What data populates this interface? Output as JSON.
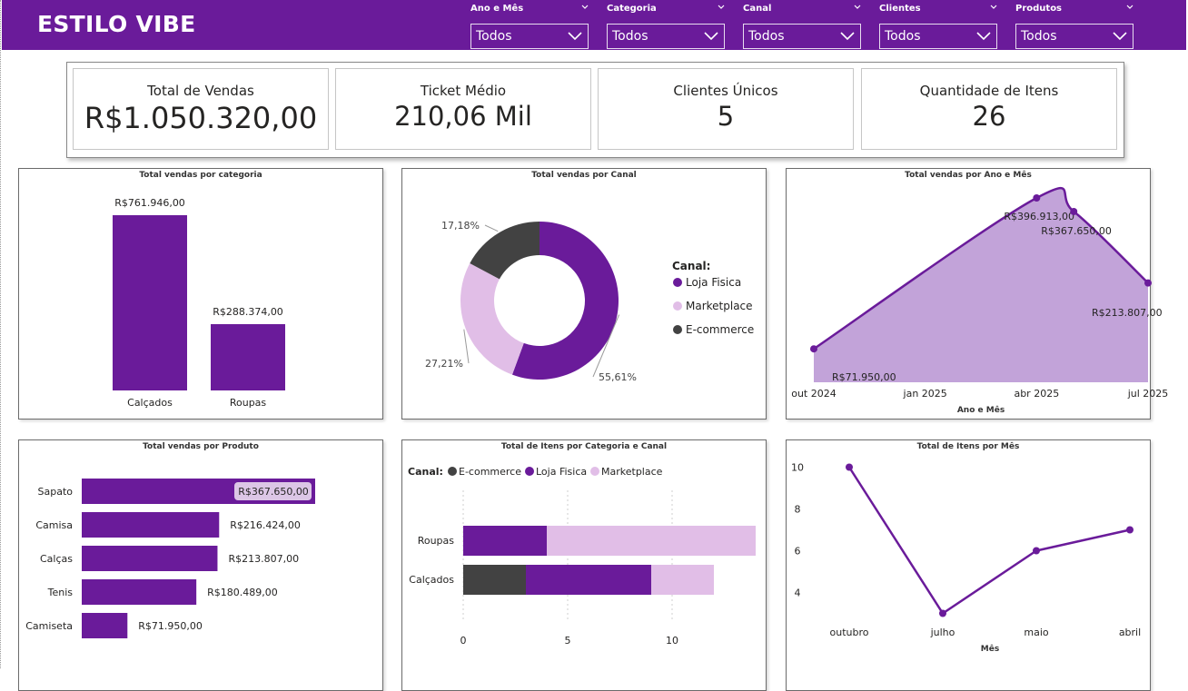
{
  "header": {
    "title": "ESTILO VIBE",
    "background_color": "#6a1b9a",
    "filters": [
      {
        "label": "Ano e Mês",
        "value": "Todos"
      },
      {
        "label": "Categoria",
        "value": "Todos"
      },
      {
        "label": "Canal",
        "value": "Todos"
      },
      {
        "label": "Clientes",
        "value": "Todos"
      },
      {
        "label": "Produtos",
        "value": "Todos"
      }
    ]
  },
  "kpis": [
    {
      "label": "Total de Vendas",
      "value": "R$1.050.320,00"
    },
    {
      "label": "Ticket Médio",
      "value": "210,06 Mil"
    },
    {
      "label": "Clientes Únicos",
      "value": "5"
    },
    {
      "label": "Quantidade de Itens",
      "value": "26"
    }
  ],
  "colors": {
    "loja_fisica": "#6a1b9a",
    "marketplace": "#e1bee7",
    "ecommerce": "#424242",
    "area_fill": "#c2a3d9"
  },
  "chart_data": [
    {
      "type": "bar",
      "title": "Total vendas por categoria",
      "categories": [
        "Calçados",
        "Roupas"
      ],
      "values": [
        761946,
        288374
      ],
      "labels": [
        "R$761.946,00",
        "R$288.374,00"
      ]
    },
    {
      "type": "pie",
      "title": "Total vendas por Canal",
      "legend_title": "Canal:",
      "legend_position": "right",
      "categories": [
        "Loja Fisica",
        "Marketplace",
        "E-commerce"
      ],
      "values": [
        55.61,
        27.21,
        17.18
      ],
      "labels": [
        "55,61%",
        "27,21%",
        "17,18%"
      ]
    },
    {
      "type": "area",
      "title": "Total vendas por Ano e Mês",
      "xlabel": "Ano e Mês",
      "x_ticks": [
        "out 2024",
        "jan 2025",
        "abr 2025",
        "jul 2025"
      ],
      "x": [
        "2024-10",
        "2025-04",
        "2025-05",
        "2025-07"
      ],
      "values": [
        71950,
        396913,
        367650,
        213807
      ],
      "labels": [
        "R$71.950,00",
        "R$396.913,00",
        "R$367.650,00",
        "R$213.807,00"
      ]
    },
    {
      "type": "bar",
      "orientation": "horizontal",
      "title": "Total vendas por Produto",
      "categories": [
        "Sapato",
        "Camisa",
        "Calças",
        "Tenis",
        "Camiseta"
      ],
      "values": [
        367650,
        216424,
        213807,
        180489,
        71950
      ],
      "labels": [
        "R$367.650,00",
        "R$216.424,00",
        "R$213.807,00",
        "R$180.489,00",
        "R$71.950,00"
      ]
    },
    {
      "type": "bar",
      "orientation": "horizontal",
      "stacked": true,
      "title": "Total de Itens por Categoria e Canal",
      "legend_title": "Canal:",
      "legend_position": "top-left",
      "categories": [
        "Roupas",
        "Calçados"
      ],
      "series": [
        {
          "name": "E-commerce",
          "values": [
            0,
            3
          ]
        },
        {
          "name": "Loja Fisica",
          "values": [
            4,
            6
          ]
        },
        {
          "name": "Marketplace",
          "values": [
            10,
            3
          ]
        }
      ],
      "x_ticks": [
        0,
        5,
        10
      ],
      "xlim": [
        0,
        14
      ]
    },
    {
      "type": "line",
      "title": "Total de Itens por Mês",
      "xlabel": "Mês",
      "categories": [
        "outubro",
        "julho",
        "maio",
        "abril"
      ],
      "values": [
        10,
        3,
        6,
        7
      ],
      "y_ticks": [
        4,
        6,
        8,
        10
      ],
      "ylim": [
        2.5,
        10.5
      ]
    }
  ]
}
